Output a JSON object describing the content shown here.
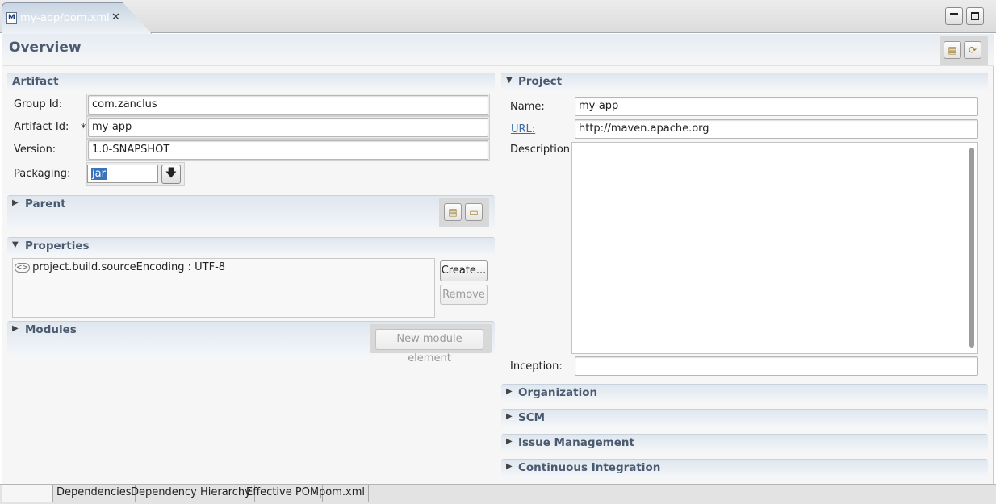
{
  "editor": {
    "tab_title": "my-app/pom.xml",
    "tab_icon": "maven-pom-icon",
    "close_glyph": "✕"
  },
  "overview": {
    "title": "Overview"
  },
  "artifact": {
    "title": "Artifact",
    "group_id_label": "Group Id:",
    "group_id_value": "com.zanclus",
    "artifact_id_label": "Artifact Id:",
    "artifact_id_value": "my-app",
    "required_marker": "*",
    "version_label": "Version:",
    "version_value": "1.0-SNAPSHOT",
    "packaging_label": "Packaging:",
    "packaging_value": "jar"
  },
  "parent": {
    "title": "Parent"
  },
  "properties": {
    "title": "Properties",
    "items": [
      {
        "icon": "property-icon",
        "text": "project.build.sourceEncoding : UTF-8"
      }
    ],
    "create_label": "Create...",
    "remove_label": "Remove"
  },
  "modules": {
    "title": "Modules",
    "new_module_label": "New module element"
  },
  "project": {
    "title": "Project",
    "name_label": "Name:",
    "name_value": "my-app",
    "url_label": "URL:",
    "url_value": "http://maven.apache.org",
    "description_label": "Description:",
    "description_value": "",
    "inception_label": "Inception:",
    "inception_value": ""
  },
  "collapsed_sections": {
    "organization": "Organization",
    "scm": "SCM",
    "issue_management": "Issue Management",
    "continuous_integration": "Continuous Integration"
  },
  "bottom_tabs": {
    "overview": "",
    "dependencies": "Dependencies",
    "dependency_hierarchy": "Dependency Hierarchy",
    "effective_pom": "Effective POM",
    "pom_xml": "pom.xml"
  },
  "colors": {
    "section_title": "#4a5a70",
    "link": "#3b6ea8",
    "selection": "#3b73b9"
  }
}
